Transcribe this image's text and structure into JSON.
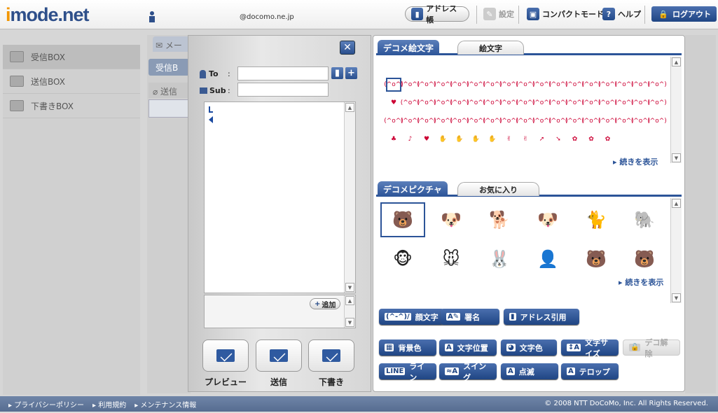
{
  "header": {
    "logo": "mode.net",
    "logo_i": "i",
    "email": "@docomo.ne.jp",
    "address_book": "アドレス帳",
    "settings": "設定",
    "compact_mode": "コンパクトモード",
    "help": "ヘルプ",
    "logout": "ログアウト"
  },
  "sidebar": {
    "items": [
      {
        "label": "受信BOX"
      },
      {
        "label": "送信BOX"
      },
      {
        "label": "下書きBOX"
      }
    ]
  },
  "background": {
    "mail_tab": "メー",
    "inbox_btn": "受信B",
    "sent_header": "送信",
    "row_text": "l"
  },
  "compose": {
    "to_label": "To",
    "sub_label": "Sub",
    "colon": ":",
    "to_value": "",
    "sub_value": "",
    "add_label": "追加",
    "preview": "プレビュー",
    "send": "送信",
    "draft": "下書き"
  },
  "deco": {
    "tab_active": "デコメ絵文字",
    "tab_other": "絵文字",
    "more": "続きを表示",
    "emoji": [
      "(^o^)",
      "(^o^)",
      "(^o^)",
      "(^o^)",
      "(^o^)",
      "(^o^)",
      "(^o^)",
      "(^o^)",
      "(^o^)",
      "(^o^)",
      "(^o^)",
      "(^o^)",
      "(^o^)",
      "(^o^)",
      "(^o^)",
      "(^o^)",
      "(^o^)",
      "♥",
      "(^o^)",
      "(^o^)",
      "(^o^)",
      "(^o^)",
      "(^o^)",
      "(^o^)",
      "(^o^)",
      "(^o^)",
      "(^o^)",
      "(^o^)",
      "(^o^)",
      "(^o^)",
      "(^o^)",
      "(^o^)",
      "(^o^)",
      "(^o^)",
      "(^o^)",
      "(^o^)",
      "(^o^)",
      "(^o^)",
      "(^o^)",
      "(^o^)",
      "(^o^)",
      "(^o^)",
      "(^o^)",
      "(^o^)",
      "(^o^)",
      "(^o^)",
      "(^o^)",
      "(^o^)",
      "(^o^)",
      "(^o^)",
      "(^o^)",
      "♣",
      "♪",
      "♥",
      "✋",
      "✋",
      "✋",
      "✋",
      "✌",
      "✌",
      "➚",
      "➘",
      "✿",
      "✿",
      "✿"
    ]
  },
  "picture": {
    "tab_active": "デコメピクチャ",
    "tab_other": "お気に入り",
    "more": "続きを表示",
    "items": [
      "🐻",
      "🐶",
      "🐕",
      "🐶",
      "🐈",
      "🐘",
      "🐵",
      "🐭",
      "🐰",
      "👤",
      "🐻",
      "🐻"
    ]
  },
  "tools": {
    "kaomoji": "顔文字",
    "kaomoji_icon": "(^-^)/",
    "signature": "署名",
    "address_quote": "アドレス引用",
    "bg_color": "背景色",
    "text_pos": "文字位置",
    "text_color": "文字色",
    "text_size": "文字サイズ",
    "deco_release": "デコ解除",
    "line": "ライン",
    "line_icon": "LINE",
    "swing": "スイング",
    "blink": "点滅",
    "telop": "テロップ"
  },
  "footer": {
    "links": [
      "プライバシーポリシー",
      "利用規約",
      "メンテナンス情報"
    ],
    "copyright": "© 2008 NTT DoCoMo, Inc. All Rights Reserved."
  },
  "colors": {
    "navy": "#1f4584",
    "accent": "#f29600"
  }
}
